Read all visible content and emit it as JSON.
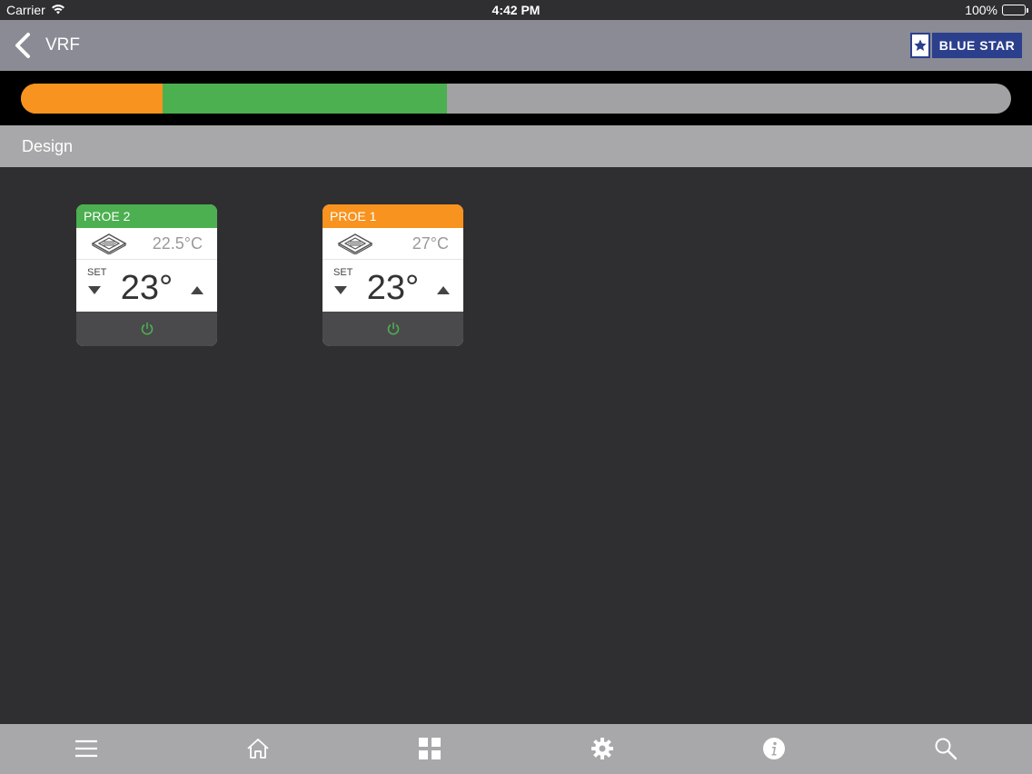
{
  "status": {
    "carrier": "Carrier",
    "time": "4:42 PM",
    "battery": "100%"
  },
  "nav": {
    "title": "VRF",
    "brand": "BLUE STAR"
  },
  "progress": {
    "segments": [
      {
        "color": "#f7931e",
        "fraction": 0.143
      },
      {
        "color": "#4caf50",
        "fraction": 0.287
      }
    ],
    "track_color": "#a2a2a4"
  },
  "section": {
    "title": "Design"
  },
  "devices": [
    {
      "name": "PROE 2",
      "header_color": "#4caf50",
      "current_temp": "22.5°C",
      "set_label": "SET",
      "set_temp": "23°"
    },
    {
      "name": "PROE 1",
      "header_color": "#f7931e",
      "current_temp": "27°C",
      "set_label": "SET",
      "set_temp": "23°"
    }
  ],
  "colors": {
    "background": "#2f2f31",
    "power_on": "#4caf50",
    "brand_blue": "#2b3f8c"
  },
  "tab_bar": {
    "icons": [
      "menu-icon",
      "home-icon",
      "grid-icon",
      "gear-icon",
      "info-icon",
      "search-icon"
    ]
  }
}
